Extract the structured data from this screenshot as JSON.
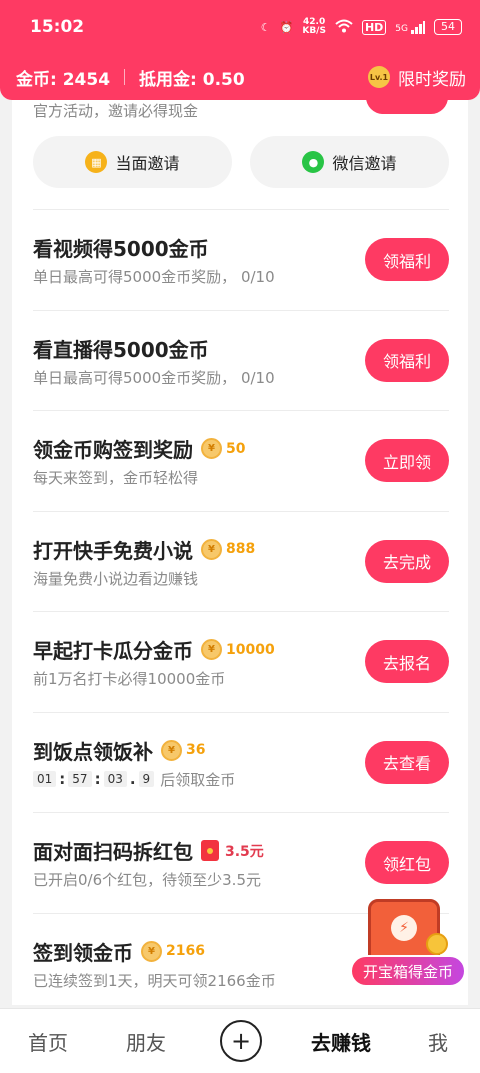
{
  "status": {
    "time": "15:02",
    "speed_value": "42.0",
    "speed_unit": "KB/S",
    "hd": "HD",
    "net": "5G",
    "battery": "54"
  },
  "header": {
    "coins_label": "金币: 2454",
    "deduct_label": "抵用金: 0.50",
    "level": "Lv.1",
    "limited_reward": "限时奖励"
  },
  "invite": {
    "desc": "官方活动，邀请必得现金",
    "face_to_face": "当面邀请",
    "wechat": "微信邀请"
  },
  "tasks": [
    {
      "title": "看视频得5000金币",
      "sub": "单日最高可得5000金币奖励， 0/10",
      "action": "领福利"
    },
    {
      "title": "看直播得5000金币",
      "sub": "单日最高可得5000金币奖励， 0/10",
      "action": "领福利"
    },
    {
      "title": "领金币购签到奖励",
      "reward": "50",
      "sub": "每天来签到，金币轻松得",
      "action": "立即领"
    },
    {
      "title": "打开快手免费小说",
      "reward": "888",
      "sub": "海量免费小说边看边赚钱",
      "action": "去完成"
    },
    {
      "title": "早起打卡瓜分金币",
      "reward": "10000",
      "sub": "前1万名打卡必得10000金币",
      "action": "去报名"
    },
    {
      "title": "到饭点领饭补",
      "reward": "36",
      "countdown": [
        "01",
        "57",
        "03",
        "9"
      ],
      "sub_suffix": "后领取金币",
      "action": "去查看"
    },
    {
      "title": "面对面扫码拆红包",
      "reward": "3.5元",
      "sub": "已开启0/6个红包，待领至少3.5元",
      "action": "领红包"
    },
    {
      "title": "签到领金币",
      "reward": "2166",
      "sub": "已连续签到1天，明天可领2166金币"
    }
  ],
  "chest": {
    "label": "开宝箱得金币"
  },
  "nav": {
    "home": "首页",
    "friends": "朋友",
    "plus": "+",
    "earn": "去赚钱",
    "me": "我"
  },
  "colors": {
    "accent": "#fe3a63",
    "coin": "#f5a10c"
  }
}
